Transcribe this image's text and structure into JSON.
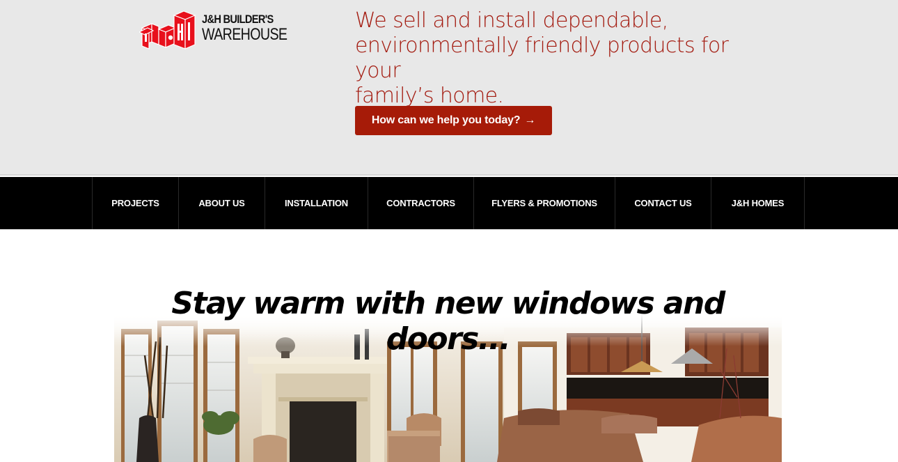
{
  "brand": {
    "logo_line1": "J&H BUILDER'S",
    "logo_line2": "WAREHOUSE",
    "logo_monogram": "J&H",
    "colors": {
      "accent": "#a61b08",
      "tagline": "#a31a0f",
      "logo_red": "#e8101c",
      "nav_bg": "#000000",
      "header_bg": "#e8e8e8"
    }
  },
  "header": {
    "tagline_line1": "We sell and install dependable,",
    "tagline_line2": "environmentally friendly products for your",
    "tagline_line3": "family’s home.",
    "cta_label": "How can we help you today?",
    "cta_icon": "→"
  },
  "nav": {
    "items": [
      {
        "label": "PROJECTS"
      },
      {
        "label": "ABOUT US"
      },
      {
        "label": "INSTALLATION"
      },
      {
        "label": "CONTRACTORS"
      },
      {
        "label": "FLYERS & PROMOTIONS"
      },
      {
        "label": "CONTACT US"
      },
      {
        "label": "J&H HOMES"
      }
    ]
  },
  "hero": {
    "title": "Stay warm with new windows and doors...",
    "image": "living-room-photo"
  }
}
